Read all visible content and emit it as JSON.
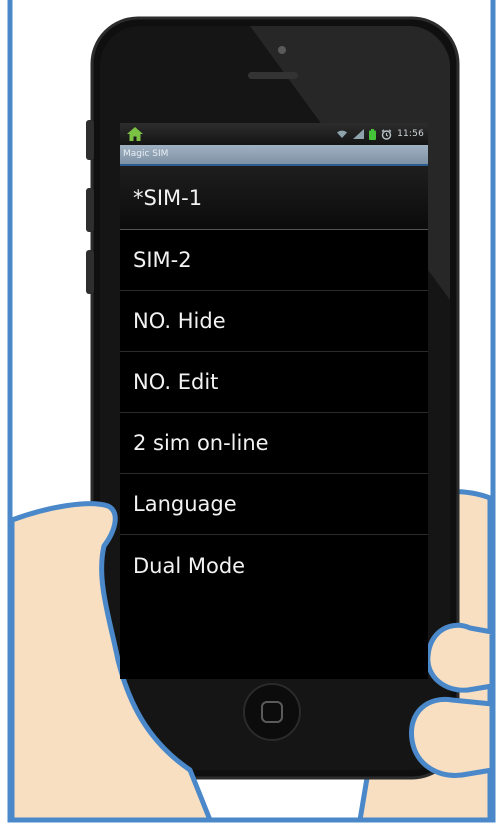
{
  "status_bar": {
    "icons": [
      "home-icon",
      "wifi-icon",
      "signal-icon",
      "battery-icon",
      "alarm-icon"
    ],
    "time": "11:56"
  },
  "app": {
    "title": "Magic SIM"
  },
  "menu": {
    "items": [
      {
        "label": "*SIM-1",
        "selected": true
      },
      {
        "label": "SIM-2",
        "selected": false
      },
      {
        "label": "NO. Hide",
        "selected": false
      },
      {
        "label": "NO. Edit",
        "selected": false
      },
      {
        "label": "2 sim on-line",
        "selected": false
      },
      {
        "label": "Language",
        "selected": false
      },
      {
        "label": "Dual Mode",
        "selected": false
      }
    ]
  },
  "colors": {
    "frame_blue": "#4a88c9",
    "skin": "#f8dfc2",
    "phone_body": "#101010",
    "title_bar": "#8fa2b5",
    "title_underline": "#2c5d91",
    "battery_green": "#45c43a"
  }
}
